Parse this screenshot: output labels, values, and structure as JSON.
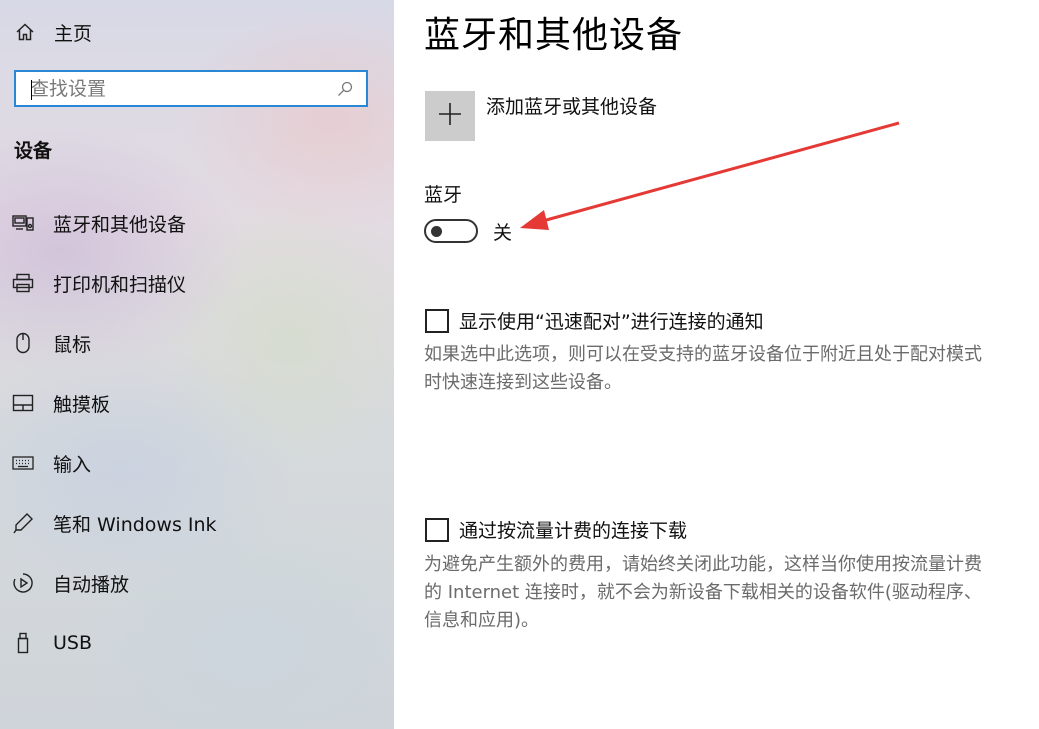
{
  "sidebar": {
    "home_label": "主页",
    "search": {
      "placeholder": "查找设置",
      "value": ""
    },
    "section_title": "设备",
    "items": [
      {
        "label": "蓝牙和其他设备",
        "icon": "bluetooth-devices-icon"
      },
      {
        "label": "打印机和扫描仪",
        "icon": "printer-icon"
      },
      {
        "label": "鼠标",
        "icon": "mouse-icon"
      },
      {
        "label": "触摸板",
        "icon": "touchpad-icon"
      },
      {
        "label": "输入",
        "icon": "keyboard-icon"
      },
      {
        "label": "笔和 Windows Ink",
        "icon": "pen-icon"
      },
      {
        "label": "自动播放",
        "icon": "autoplay-icon"
      },
      {
        "label": "USB",
        "icon": "usb-icon"
      }
    ]
  },
  "main": {
    "title": "蓝牙和其他设备",
    "add_device_label": "添加蓝牙或其他设备",
    "bluetooth": {
      "label": "蓝牙",
      "toggle_on": false,
      "state_label": "关"
    },
    "swift_pair": {
      "checked": false,
      "label": "显示使用“迅速配对”进行连接的通知",
      "description": "如果选中此选项，则可以在受支持的蓝牙设备位于附近且处于配对模式时快速连接到这些设备。"
    },
    "metered": {
      "checked": false,
      "label": "通过按流量计费的连接下载",
      "description": "为避免产生额外的费用，请始终关闭此功能，这样当你使用按流量计费的 Internet 连接时，就不会为新设备下载相关的设备软件(驱动程序、信息和应用)。"
    }
  },
  "colors": {
    "accent": "#2a87d6",
    "annotation_arrow": "#e53935",
    "description_text": "#6b6b6b",
    "add_button_bg": "#cccccc"
  }
}
